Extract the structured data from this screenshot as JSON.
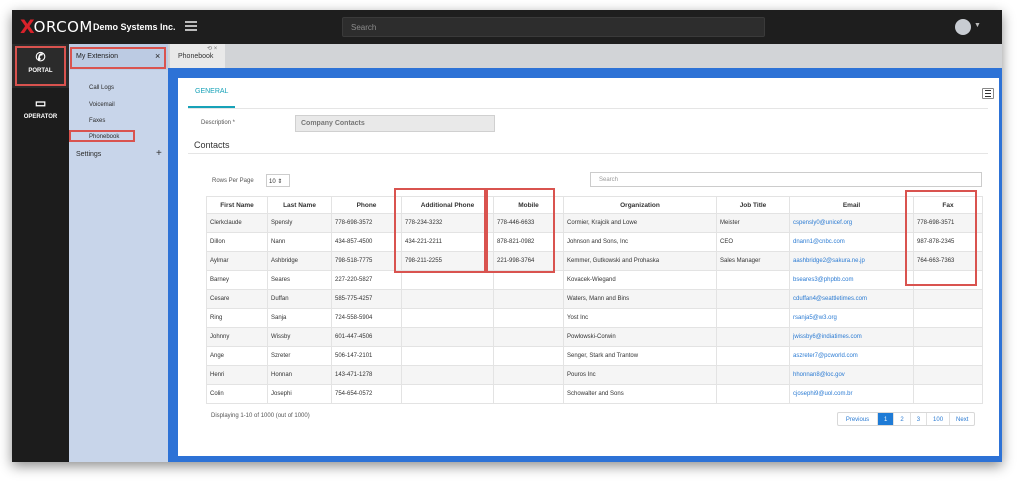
{
  "header": {
    "logo_x": "X",
    "logo_word": "ORCOM",
    "company": "Demo Systems Inc.",
    "search_placeholder": "Search"
  },
  "rail": {
    "portal_label": "PORTAL",
    "operator_label": "OPERATOR"
  },
  "sidemenu": {
    "title": "My Extension",
    "close": "×",
    "items": [
      "Call Logs",
      "Voicemail",
      "Faxes",
      "Phonebook"
    ],
    "settings_label": "Settings",
    "settings_plus": "+"
  },
  "tabbar": {
    "tab_label": "Phonebook",
    "tab_icons": "⟲ ×"
  },
  "panel": {
    "tab_general": "GENERAL",
    "description_label": "Description *",
    "description_value": "Company Contacts",
    "contacts_label": "Contacts",
    "rows_per_page_label": "Rows Per Page",
    "rows_per_page_value": "10",
    "table_search_placeholder": "Search",
    "columns": [
      "First Name",
      "Last Name",
      "Phone",
      "Additional Phone",
      "Mobile",
      "Organization",
      "Job Title",
      "Email",
      "Fax"
    ],
    "rows": [
      [
        "Clerkclaude",
        "Spensly",
        "778-698-3572",
        "778-234-3232",
        "778-446-6633",
        "Cormier, Krajcik and Lowe",
        "Meister",
        "cspensly0@unicef.org",
        "778-698-3571"
      ],
      [
        "Dillon",
        "Nann",
        "434-857-4500",
        "434-221-2211",
        "878-821-0982",
        "Johnson and Sons, Inc",
        "CEO",
        "dnann1@cnbc.com",
        "987-878-2345"
      ],
      [
        "Aylmar",
        "Ashbridge",
        "798-518-7775",
        "798-211-2255",
        "221-998-3764",
        "Kemmer, Gutkowski and Prohaska",
        "Sales Manager",
        "aashbridge2@sakura.ne.jp",
        "764-663-7363"
      ],
      [
        "Barney",
        "Seares",
        "227-220-5827",
        "",
        "",
        "Kovacek-Wiegand",
        "",
        "bseares3@phpbb.com",
        ""
      ],
      [
        "Cesare",
        "Duffan",
        "585-775-4257",
        "",
        "",
        "Waters, Mann and Bins",
        "",
        "cduffan4@seattletimes.com",
        ""
      ],
      [
        "Ring",
        "Sanja",
        "724-558-5904",
        "",
        "",
        "Yost Inc",
        "",
        "rsanja5@w3.org",
        ""
      ],
      [
        "Johnny",
        "Wissby",
        "601-447-4506",
        "",
        "",
        "Powlowski-Corwin",
        "",
        "jwissby6@indiatimes.com",
        ""
      ],
      [
        "Ange",
        "Szreter",
        "506-147-2101",
        "",
        "",
        "Senger, Stark and Trantow",
        "",
        "aszreter7@pcworld.com",
        ""
      ],
      [
        "Henri",
        "Honnan",
        "143-471-1278",
        "",
        "",
        "Pouros Inc",
        "",
        "hhonnan8@loc.gov",
        ""
      ],
      [
        "Colin",
        "Josephi",
        "754-654-0572",
        "",
        "",
        "Schowalter and Sons",
        "",
        "cjosephi9@uol.com.br",
        ""
      ]
    ],
    "footer_text": "Displaying 1-10 of 1000 (out of 1000)",
    "pager": [
      "Previous",
      "1",
      "2",
      "3",
      "100",
      "Next"
    ],
    "pager_active": "1"
  },
  "colors": {
    "accent_teal": "#17a2b8",
    "link_blue": "#2b7bd3",
    "highlight_red": "#d9534f",
    "content_blue": "#2d72d6",
    "brand_red": "#d9222a"
  },
  "icons": {
    "portal": "phone-icon",
    "operator": "monitor-icon",
    "menu_toggle": "hamburger-icon",
    "user": "avatar-icon",
    "list_view": "list-icon"
  }
}
